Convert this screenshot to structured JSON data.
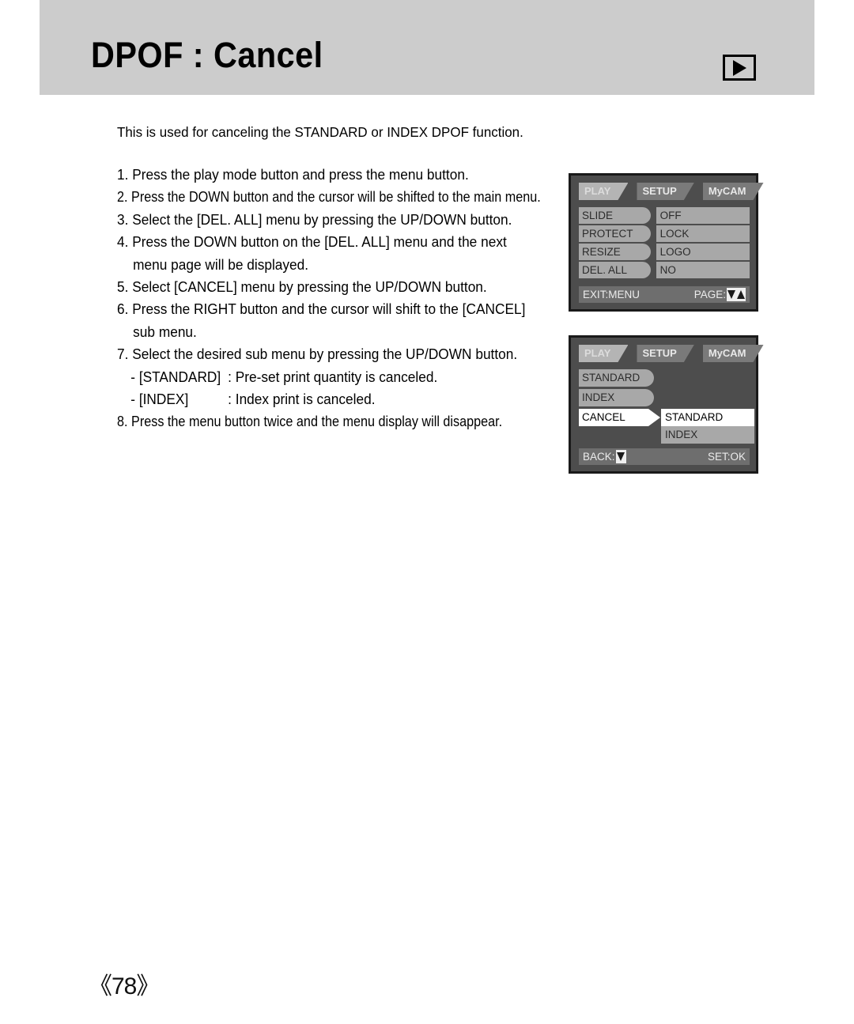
{
  "header": {
    "title": "DPOF : Cancel",
    "play_icon": "play-triangle-icon"
  },
  "content": {
    "intro": "This is used for canceling the STANDARD or INDEX DPOF function.",
    "steps": [
      "1. Press the play mode button and press the menu button.",
      "2. Press the DOWN button and the cursor will be shifted to the main menu.",
      "3. Select the [DEL. ALL] menu by pressing the UP/DOWN button.",
      "4. Press the DOWN button on the [DEL. ALL] menu and the next",
      "menu page will be displayed.",
      "5. Select [CANCEL] menu by pressing the UP/DOWN button.",
      "6. Press the RIGHT button and the cursor will shift to the [CANCEL]",
      "sub menu.",
      "7. Select the desired sub menu by pressing the UP/DOWN button."
    ],
    "sub_items": [
      {
        "label": "- [STANDARD]",
        "desc": ": Pre-set print quantity is canceled."
      },
      {
        "label": "- [INDEX]",
        "desc": ": Index print is canceled."
      }
    ],
    "final_step": "8. Press the menu button twice and the menu display will disappear."
  },
  "lcd1": {
    "tabs": [
      {
        "label": "PLAY",
        "active": true
      },
      {
        "label": "SETUP",
        "active": false
      },
      {
        "label": "MyCAM",
        "active": false
      }
    ],
    "rows": [
      {
        "name": "SLIDE",
        "value": "OFF"
      },
      {
        "name": "PROTECT",
        "value": "LOCK"
      },
      {
        "name": "RESIZE",
        "value": "LOGO"
      },
      {
        "name": "DEL. ALL",
        "value": "NO"
      }
    ],
    "status_left": "EXIT:MENU",
    "status_right": "PAGE:"
  },
  "lcd2": {
    "tabs": [
      {
        "label": "PLAY",
        "active": true
      },
      {
        "label": "SETUP",
        "active": false
      },
      {
        "label": "MyCAM",
        "active": false
      }
    ],
    "items": [
      {
        "label": "STANDARD",
        "selected": false
      },
      {
        "label": "INDEX",
        "selected": false
      },
      {
        "label": "CANCEL",
        "selected": true
      }
    ],
    "submenu": [
      {
        "label": "STANDARD",
        "selected": true
      },
      {
        "label": "INDEX",
        "selected": false
      }
    ],
    "status_left": "BACK:",
    "status_right": "SET:OK"
  },
  "footer": {
    "page_number": "《78》"
  },
  "colors": {
    "header_band": "#cccccc",
    "lcd_background": "#4d4d4d",
    "lcd_item": "#a8a8a8",
    "lcd_tab_active": "#b4b4b4",
    "lcd_tab": "#7a7a7a",
    "lcd_statusbar": "#6e6e6e",
    "selected": "#ffffff"
  }
}
